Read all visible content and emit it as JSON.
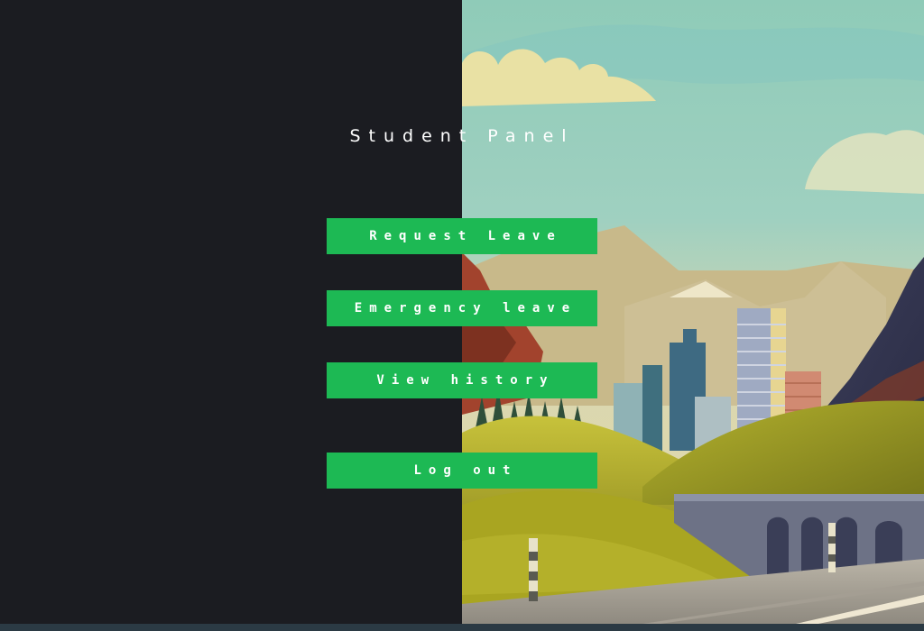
{
  "panel": {
    "title": "Student Panel"
  },
  "menu": {
    "request_leave": "Request Leave",
    "emergency_leave": "Emergency leave",
    "view_history": "View history",
    "log_out": "Log out"
  },
  "colors": {
    "background_dark": "#1b1c21",
    "button_green": "#1db954",
    "text_white": "#ffffff"
  }
}
